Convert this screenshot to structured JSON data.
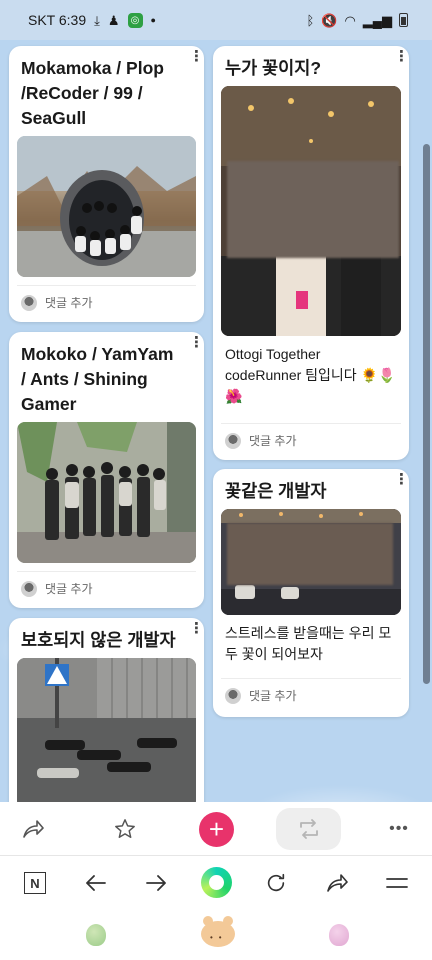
{
  "status_bar": {
    "carrier_time": "SKT 6:39",
    "icons_left": [
      "download-icon",
      "person-icon",
      "app-badge-icon",
      "dot-icon"
    ],
    "icons_right": [
      "bluetooth-icon",
      "mute-icon",
      "wifi-icon",
      "signal-icon",
      "battery-icon"
    ]
  },
  "colors": {
    "board_background": "#b9d5f0",
    "plus_button": "#e8336b",
    "accent_green": "#1fd36b"
  },
  "board": {
    "left_column": [
      {
        "title": "Mokamoka / Plop /ReCoder / 99 / SeaGull",
        "image": "group photo in dome sculpture",
        "comment_label": "댓글 추가"
      },
      {
        "title": "Mokoko / YamYam / Ants / Shining Gamer",
        "image": "group photo among plants",
        "comment_label": "댓글 추가"
      },
      {
        "title": "보호되지 않은 개발자",
        "image": "people lying on floor beside crosswalk sign"
      }
    ],
    "right_column": [
      {
        "title": "누가 꽃이지?",
        "image": "blurred group photo in cafe",
        "body": "Ottogi Together codeRunner 팀입니다 🌻🌷🌺",
        "comment_label": "댓글 추가"
      },
      {
        "title": "꽃같은 개발자",
        "image": "blurred group photo in hall",
        "body": "스트레스를 받을때는 우리 모두 꽃이 되어보자",
        "comment_label": "댓글 추가"
      }
    ]
  },
  "action_bar": {
    "buttons": [
      "share-icon",
      "star-icon",
      "plus-icon",
      "repost-icon",
      "more-icon"
    ]
  },
  "nav_bar": {
    "logo_letter": "N",
    "buttons": [
      "naver-logo",
      "back-icon",
      "forward-icon",
      "home-icon",
      "refresh-icon",
      "share-icon",
      "menu-icon"
    ]
  },
  "sticker_bar": {
    "items": [
      "green-bean-sticker",
      "bear-sticker",
      "pink-bean-sticker"
    ]
  }
}
